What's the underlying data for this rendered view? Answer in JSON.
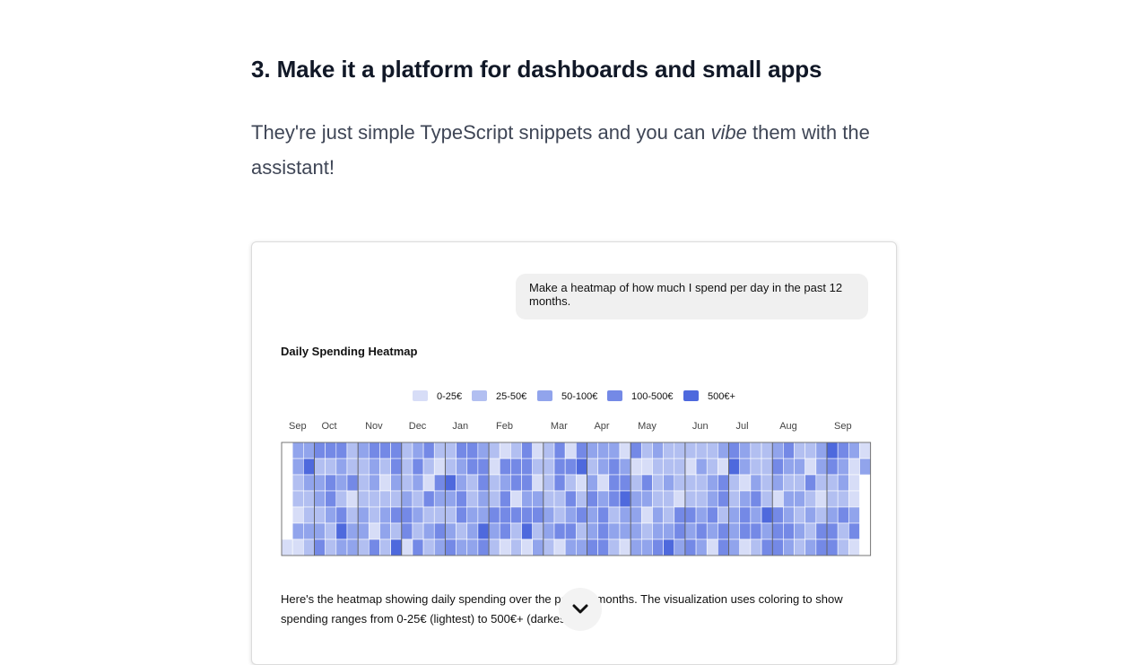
{
  "article": {
    "heading": "3. Make it a platform for dashboards and small apps",
    "intro_before": "They're just simple TypeScript snippets and you can ",
    "intro_emphasis": "vibe",
    "intro_after": " them with the assistant!"
  },
  "chat": {
    "user_message": "Make a heatmap of how much I spend per day in the past 12 months.",
    "response_text": "Here's the heatmap showing daily spending over the past 12 months. The visualization uses coloring to show spending ranges from 0-25€ (lightest) to 500€+ (darkest)."
  },
  "scroll_button": {
    "icon": "chevron-down-icon"
  },
  "chart_data": {
    "type": "heatmap",
    "title": "Daily Spending Heatmap",
    "legend": [
      "0-25€",
      "25-50€",
      "50-100€",
      "100-500€",
      "500€+"
    ],
    "legend_colors": [
      "#d7ddf7",
      "#b2bff1",
      "#91a4ec",
      "#7489e6",
      "#4e69dd"
    ],
    "empty_color": "#f2f2f2",
    "month_labels": [
      "Sep",
      "Oct",
      "Nov",
      "Dec",
      "Jan",
      "Feb",
      "Mar",
      "Apr",
      "May",
      "Jun",
      "Jul",
      "Aug",
      "Sep"
    ],
    "month_start_weeks": [
      0,
      3,
      7,
      11,
      15,
      19,
      24,
      28,
      32,
      37,
      41,
      45,
      50
    ],
    "date_range": [
      "2024-09-14",
      "2025-09-14"
    ],
    "rows_per_week": 7,
    "weeks": 54,
    "values": [
      [
        null,
        null,
        null,
        null,
        null,
        null,
        0
      ],
      [
        2,
        2,
        1,
        1,
        0,
        2,
        0
      ],
      [
        2,
        4,
        2,
        1,
        1,
        2,
        1
      ],
      [
        3,
        1,
        2,
        2,
        1,
        2,
        3
      ],
      [
        3,
        1,
        3,
        3,
        2,
        1,
        1
      ],
      [
        3,
        2,
        2,
        1,
        3,
        4,
        2
      ],
      [
        1,
        1,
        3,
        0,
        1,
        2,
        2
      ],
      [
        2,
        1,
        1,
        1,
        2,
        2,
        1
      ],
      [
        3,
        2,
        2,
        1,
        1,
        0,
        3
      ],
      [
        3,
        1,
        0,
        1,
        2,
        2,
        1
      ],
      [
        3,
        3,
        2,
        1,
        3,
        1,
        4
      ],
      [
        1,
        1,
        1,
        2,
        3,
        3,
        0
      ],
      [
        2,
        3,
        2,
        1,
        2,
        1,
        3
      ],
      [
        3,
        1,
        0,
        3,
        1,
        2,
        1
      ],
      [
        1,
        0,
        3,
        2,
        1,
        3,
        2
      ],
      [
        1,
        1,
        4,
        2,
        1,
        2,
        3
      ],
      [
        3,
        2,
        2,
        3,
        3,
        1,
        2
      ],
      [
        3,
        3,
        1,
        1,
        2,
        2,
        2
      ],
      [
        2,
        3,
        3,
        2,
        2,
        4,
        3
      ],
      [
        1,
        0,
        1,
        1,
        3,
        2,
        1
      ],
      [
        0,
        3,
        2,
        3,
        3,
        3,
        0
      ],
      [
        1,
        3,
        3,
        0,
        3,
        1,
        1
      ],
      [
        3,
        3,
        3,
        2,
        3,
        4,
        0
      ],
      [
        0,
        1,
        0,
        2,
        3,
        1,
        2
      ],
      [
        1,
        1,
        1,
        1,
        2,
        2,
        1
      ],
      [
        3,
        3,
        3,
        1,
        1,
        3,
        0
      ],
      [
        0,
        3,
        1,
        3,
        2,
        3,
        2
      ],
      [
        3,
        4,
        0,
        1,
        3,
        1,
        2
      ],
      [
        2,
        1,
        2,
        3,
        2,
        2,
        3
      ],
      [
        2,
        2,
        0,
        2,
        3,
        3,
        3
      ],
      [
        2,
        3,
        3,
        3,
        1,
        2,
        1
      ],
      [
        0,
        2,
        3,
        4,
        2,
        2,
        0
      ],
      [
        3,
        0,
        1,
        2,
        2,
        2,
        2
      ],
      [
        1,
        0,
        3,
        2,
        0,
        1,
        2
      ],
      [
        2,
        1,
        1,
        1,
        2,
        2,
        3
      ],
      [
        1,
        1,
        2,
        1,
        1,
        2,
        4
      ],
      [
        1,
        1,
        1,
        0,
        3,
        3,
        2
      ],
      [
        1,
        0,
        1,
        1,
        3,
        2,
        3
      ],
      [
        1,
        2,
        1,
        1,
        2,
        3,
        2
      ],
      [
        1,
        1,
        2,
        2,
        3,
        2,
        0
      ],
      [
        2,
        0,
        3,
        3,
        1,
        3,
        3
      ],
      [
        3,
        4,
        1,
        1,
        2,
        2,
        2
      ],
      [
        2,
        2,
        0,
        2,
        3,
        3,
        0
      ],
      [
        1,
        1,
        2,
        3,
        2,
        3,
        1
      ],
      [
        1,
        1,
        1,
        1,
        4,
        2,
        3
      ],
      [
        2,
        3,
        2,
        0,
        3,
        3,
        3
      ],
      [
        3,
        2,
        1,
        2,
        2,
        3,
        2
      ],
      [
        1,
        2,
        1,
        2,
        1,
        2,
        1
      ],
      [
        1,
        0,
        3,
        1,
        2,
        1,
        2
      ],
      [
        2,
        2,
        1,
        0,
        1,
        3,
        3
      ],
      [
        4,
        3,
        1,
        1,
        2,
        3,
        3
      ],
      [
        3,
        2,
        2,
        1,
        3,
        1,
        1
      ],
      [
        2,
        0,
        0,
        0,
        2,
        3,
        0
      ],
      [
        0,
        2,
        null,
        null,
        null,
        null,
        null
      ]
    ]
  }
}
